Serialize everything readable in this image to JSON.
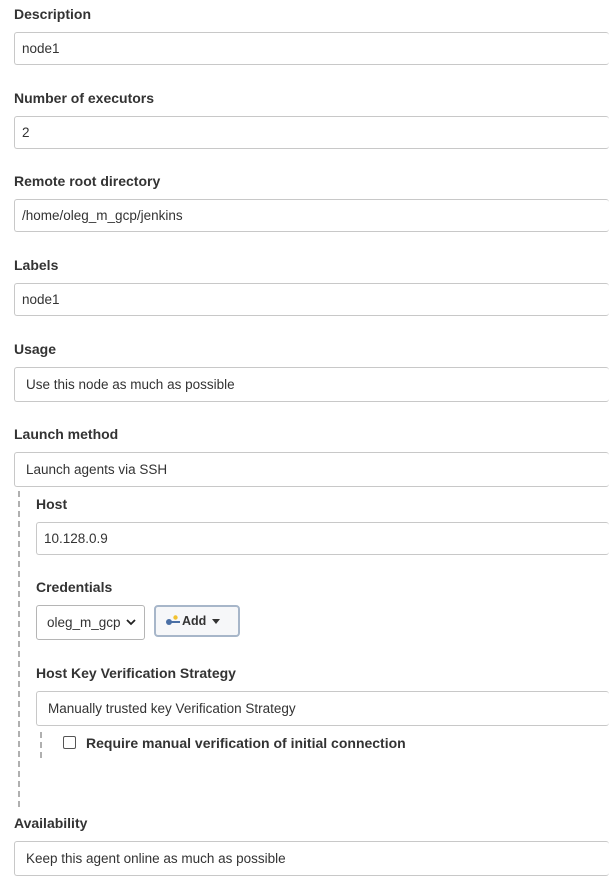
{
  "fields": {
    "description": {
      "label": "Description",
      "value": "node1"
    },
    "executors": {
      "label": "Number of executors",
      "value": "2"
    },
    "remote_root": {
      "label": "Remote root directory",
      "value": "/home/oleg_m_gcp/jenkins"
    },
    "labels": {
      "label": "Labels",
      "value": "node1"
    },
    "usage": {
      "label": "Usage",
      "value": "Use this node as much as possible"
    },
    "launch_method": {
      "label": "Launch method",
      "value": "Launch agents via SSH"
    },
    "host": {
      "label": "Host",
      "value": "10.128.0.9"
    },
    "credentials": {
      "label": "Credentials",
      "value": "oleg_m_gcp",
      "add_label": "Add"
    },
    "host_key": {
      "label": "Host Key Verification Strategy",
      "value": "Manually trusted key Verification Strategy"
    },
    "manual_verification": {
      "label": "Require manual verification of initial connection",
      "checked": false
    },
    "availability": {
      "label": "Availability",
      "value": "Keep this agent online as much as possible"
    }
  },
  "icons": {
    "key": "key-icon",
    "caret": "caret-down-icon",
    "chevron": "chevron-down-icon"
  },
  "colors": {
    "accent_border": "#a7b6c9",
    "key_yellow": "#f2c230",
    "key_blue": "#4a6fa5"
  }
}
